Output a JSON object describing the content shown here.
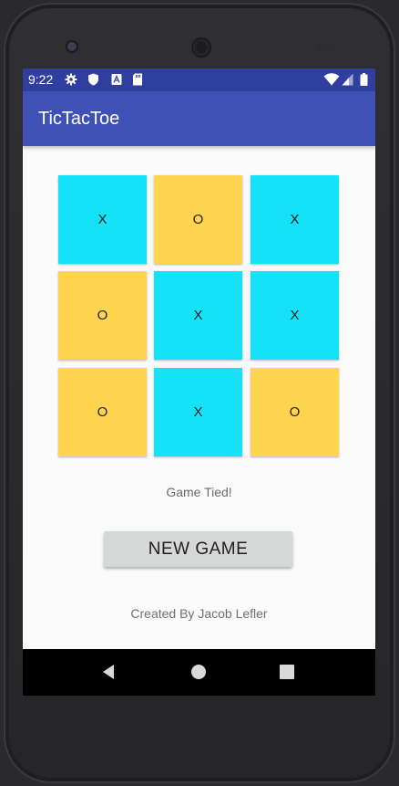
{
  "status_bar": {
    "time": "9:22",
    "left_icons": [
      "gear-icon",
      "shield-icon",
      "a-box-icon",
      "sd-card-icon"
    ],
    "right_icons": [
      "wifi-icon",
      "cell-signal-icon",
      "battery-icon"
    ],
    "color": "#303f9f"
  },
  "app_bar": {
    "title": "TicTacToe",
    "color": "#3f51b5"
  },
  "board": {
    "x_color": "#15e1f7",
    "o_color": "#ffd54f",
    "cells": [
      {
        "mark": "X"
      },
      {
        "mark": "O"
      },
      {
        "mark": "X"
      },
      {
        "mark": "O"
      },
      {
        "mark": "X"
      },
      {
        "mark": "X"
      },
      {
        "mark": "O"
      },
      {
        "mark": "X"
      },
      {
        "mark": "O"
      }
    ]
  },
  "game_status": "Game Tied!",
  "new_game_button": {
    "label": "NEW GAME"
  },
  "footer": {
    "credit": "Created By Jacob Lefler"
  },
  "nav_bar": {
    "buttons": [
      "back-icon",
      "home-icon",
      "recents-icon"
    ]
  }
}
